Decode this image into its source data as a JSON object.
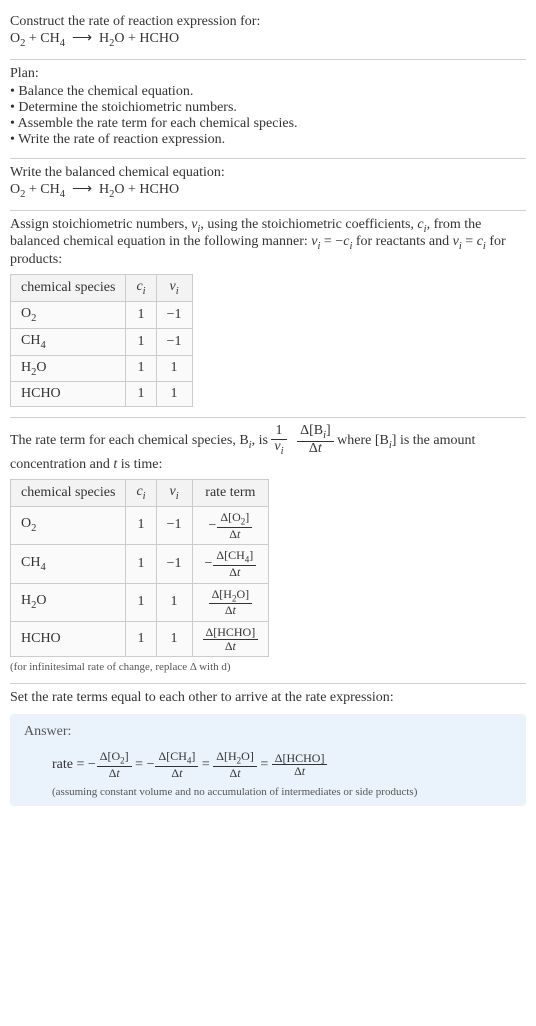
{
  "intro": {
    "prompt": "Construct the rate of reaction expression for:",
    "equation_html": "O<sub>2</sub> + CH<sub>4</sub> &nbsp;⟶&nbsp; H<sub>2</sub>O + HCHO"
  },
  "plan": {
    "title": "Plan:",
    "items": [
      "Balance the chemical equation.",
      "Determine the stoichiometric numbers.",
      "Assemble the rate term for each chemical species.",
      "Write the rate of reaction expression."
    ]
  },
  "balanced": {
    "title": "Write the balanced chemical equation:",
    "equation_html": "O<sub>2</sub> + CH<sub>4</sub> &nbsp;⟶&nbsp; H<sub>2</sub>O + HCHO"
  },
  "stoich": {
    "text_html": "Assign stoichiometric numbers, <span class='ital'>ν<sub>i</sub></span>, using the stoichiometric coefficients, <span class='ital'>c<sub>i</sub></span>, from the balanced chemical equation in the following manner: <span class='ital'>ν<sub>i</sub></span> = −<span class='ital'>c<sub>i</sub></span> for reactants and <span class='ital'>ν<sub>i</sub></span> = <span class='ital'>c<sub>i</sub></span> for products:",
    "headers": {
      "species": "chemical species",
      "ci_html": "<span class='ital'>c<sub>i</sub></span>",
      "vi_html": "<span class='ital'>ν<sub>i</sub></span>"
    },
    "rows": [
      {
        "species_html": "O<sub>2</sub>",
        "ci": "1",
        "vi": "−1"
      },
      {
        "species_html": "CH<sub>4</sub>",
        "ci": "1",
        "vi": "−1"
      },
      {
        "species_html": "H<sub>2</sub>O",
        "ci": "1",
        "vi": "1"
      },
      {
        "species_html": "HCHO",
        "ci": "1",
        "vi": "1"
      }
    ]
  },
  "rateterm": {
    "pre_text_html": "The rate term for each chemical species, B<sub><span class='ital'>i</span></sub>, is ",
    "frac1_num": "1",
    "frac1_den_html": "<span class='ital'>ν<sub>i</sub></span>",
    "frac2_num_html": "Δ[B<sub><span class='ital'>i</span></sub>]",
    "frac2_den_html": "Δ<span class='ital'>t</span>",
    "post_text_html": " where [B<sub><span class='ital'>i</span></sub>] is the amount concentration and <span class='ital'>t</span> is time:",
    "headers": {
      "species": "chemical species",
      "ci_html": "<span class='ital'>c<sub>i</sub></span>",
      "vi_html": "<span class='ital'>ν<sub>i</sub></span>",
      "rate": "rate term"
    },
    "rows": [
      {
        "species_html": "O<sub>2</sub>",
        "ci": "1",
        "vi": "−1",
        "rate_num_html": "Δ[O<sub>2</sub>]",
        "rate_den_html": "Δ<span class='ital'>t</span>",
        "neg": true
      },
      {
        "species_html": "CH<sub>4</sub>",
        "ci": "1",
        "vi": "−1",
        "rate_num_html": "Δ[CH<sub>4</sub>]",
        "rate_den_html": "Δ<span class='ital'>t</span>",
        "neg": true
      },
      {
        "species_html": "H<sub>2</sub>O",
        "ci": "1",
        "vi": "1",
        "rate_num_html": "Δ[H<sub>2</sub>O]",
        "rate_den_html": "Δ<span class='ital'>t</span>",
        "neg": false
      },
      {
        "species_html": "HCHO",
        "ci": "1",
        "vi": "1",
        "rate_num_html": "Δ[HCHO]",
        "rate_den_html": "Δ<span class='ital'>t</span>",
        "neg": false
      }
    ],
    "caption": "(for infinitesimal rate of change, replace Δ with d)"
  },
  "final": {
    "text": "Set the rate terms equal to each other to arrive at the rate expression:"
  },
  "answer": {
    "title": "Answer:",
    "rate_label": "rate = ",
    "terms": [
      {
        "neg": true,
        "num_html": "Δ[O<sub>2</sub>]",
        "den_html": "Δ<span class='ital'>t</span>"
      },
      {
        "neg": true,
        "num_html": "Δ[CH<sub>4</sub>]",
        "den_html": "Δ<span class='ital'>t</span>"
      },
      {
        "neg": false,
        "num_html": "Δ[H<sub>2</sub>O]",
        "den_html": "Δ<span class='ital'>t</span>"
      },
      {
        "neg": false,
        "num_html": "Δ[HCHO]",
        "den_html": "Δ<span class='ital'>t</span>"
      }
    ],
    "note": "(assuming constant volume and no accumulation of intermediates or side products)"
  },
  "chart_data": {
    "type": "table",
    "title": "Stoichiometric numbers and rate terms",
    "columns": [
      "chemical species",
      "c_i",
      "ν_i",
      "rate term"
    ],
    "rows": [
      [
        "O2",
        1,
        -1,
        "-Δ[O2]/Δt"
      ],
      [
        "CH4",
        1,
        -1,
        "-Δ[CH4]/Δt"
      ],
      [
        "H2O",
        1,
        1,
        "Δ[H2O]/Δt"
      ],
      [
        "HCHO",
        1,
        1,
        "Δ[HCHO]/Δt"
      ]
    ],
    "rate_expression": "rate = -Δ[O2]/Δt = -Δ[CH4]/Δt = Δ[H2O]/Δt = Δ[HCHO]/Δt"
  }
}
